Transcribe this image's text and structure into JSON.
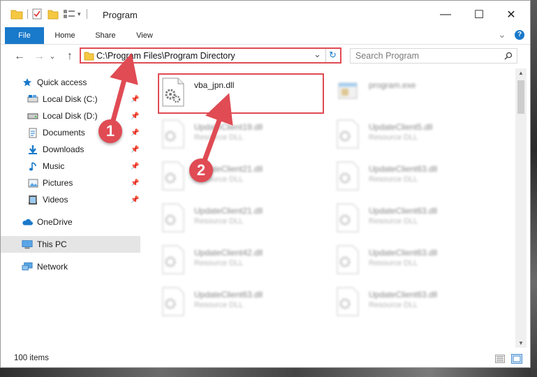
{
  "window": {
    "title": "Program",
    "minimize_glyph": "—",
    "maximize_glyph": "☐",
    "close_glyph": "✕"
  },
  "ribbon": {
    "tabs": [
      "File",
      "Home",
      "Share",
      "View"
    ],
    "expand_glyph": "⌄",
    "help_glyph": "?"
  },
  "nav": {
    "back_glyph": "←",
    "forward_glyph": "→",
    "history_glyph": "⌄",
    "up_glyph": "↑",
    "refresh_glyph": "↻",
    "address_dropdown_glyph": "⌄",
    "address": "C:\\Program Files\\Program Directory",
    "search_placeholder": "Search Program"
  },
  "sidebar": {
    "items": [
      {
        "label": "Quick access",
        "icon": "star-icon"
      },
      {
        "label": "Local Disk (C:)",
        "icon": "drive-icon"
      },
      {
        "label": "Local Disk (D:)",
        "icon": "drive-icon"
      },
      {
        "label": "Documents",
        "icon": "documents-icon"
      },
      {
        "label": "Downloads",
        "icon": "download-icon"
      },
      {
        "label": "Music",
        "icon": "music-icon"
      },
      {
        "label": "Pictures",
        "icon": "pictures-icon"
      },
      {
        "label": "Videos",
        "icon": "videos-icon"
      },
      {
        "label": "OneDrive",
        "icon": "cloud-icon"
      },
      {
        "label": "This PC",
        "icon": "computer-icon"
      },
      {
        "label": "Network",
        "icon": "network-icon"
      }
    ]
  },
  "files": [
    {
      "name": "vba_jpn.dll",
      "type": ""
    },
    {
      "name": "program.exe",
      "type": ""
    },
    {
      "name": "UpdateClient19.dll",
      "type": "Resource DLL"
    },
    {
      "name": "UpdateClient5.dll",
      "type": "Resource DLL"
    },
    {
      "name": "UpdateClient21.dll",
      "type": "Resource DLL"
    },
    {
      "name": "UpdateClient63.dll",
      "type": "Resource DLL"
    },
    {
      "name": "UpdateClient21.dll",
      "type": "Resource DLL"
    },
    {
      "name": "UpdateClient63.dll",
      "type": "Resource DLL"
    },
    {
      "name": "UpdateClient42.dll",
      "type": "Resource DLL"
    },
    {
      "name": "UpdateClient63.dll",
      "type": "Resource DLL"
    },
    {
      "name": "UpdateClient63.dll",
      "type": "Resource DLL"
    },
    {
      "name": "UpdateClient63.dll",
      "type": "Resource DLL"
    }
  ],
  "status": {
    "item_count": "100 items"
  },
  "annotations": {
    "step1": "1",
    "step2": "2"
  },
  "colors": {
    "accent": "#1979ca",
    "highlight": "#e04b54",
    "folder": "#f5c842"
  }
}
